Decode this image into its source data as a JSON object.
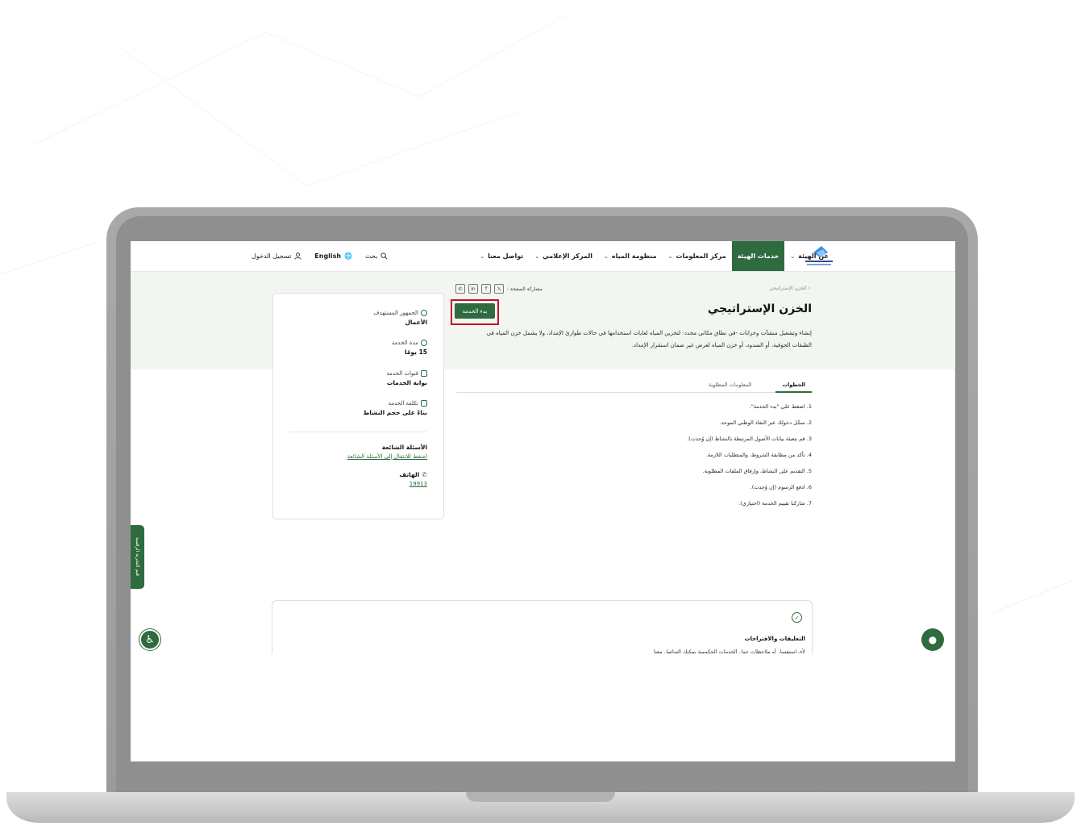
{
  "header": {
    "nav": [
      {
        "label": "عن الهيئة",
        "active": false,
        "dropdown": true
      },
      {
        "label": "خدمات الهيئة",
        "active": true,
        "dropdown": false
      },
      {
        "label": "مركز المعلومات",
        "active": false,
        "dropdown": true
      },
      {
        "label": "منظومة المياه",
        "active": false,
        "dropdown": true
      },
      {
        "label": "المركز الإعلامي",
        "active": false,
        "dropdown": true
      },
      {
        "label": "تواصل معنا",
        "active": false,
        "dropdown": true
      }
    ],
    "search_label": "بحث",
    "language_label": "English",
    "login_label": "تسجيل الدخول"
  },
  "breadcrumb": "الخزن الإستراتيجي",
  "share": {
    "label": "مشاركة الصفحة :",
    "icons": [
      "x-icon",
      "facebook-icon",
      "linkedin-icon",
      "whatsapp-icon"
    ]
  },
  "page": {
    "title": "الخزن الإستراتيجي",
    "description": "إنشاء وتشغيل منشآت وخزانات -في نطاق مكاني محدد- لتخزين المياه لغايات استخدامها في حالات طوارئ الإمداد، ولا يشمل خزن المياه في الطبقات الجوفية، أو السدود، أو خزن المياه لغرض غير ضمان استقرار الإمداد.",
    "start_button": "بدء الخدمة"
  },
  "info_card": {
    "audience_label": "الجمهور المستهدف",
    "audience_value": "الأعمال",
    "duration_label": "مدة الخدمة",
    "duration_value": "15 يومًا",
    "channels_label": "قنوات الخدمة",
    "channels_value": "بوابة الخدمات",
    "cost_label": "تكلفة الخدمة",
    "cost_value": "بناءً على حجم النشاط",
    "faq_label": "الأسئلة الشائعة",
    "faq_link": "اضغط للانتقال إلى الأسئلة الشائعة",
    "phone_label": "الهاتف",
    "phone_value": "19913"
  },
  "tabs": [
    {
      "label": "الخطوات",
      "active": true
    },
    {
      "label": "المعلومات المطلوبة",
      "active": false
    }
  ],
  "steps": [
    "1. اضغط على \"بدء الخدمة\".",
    "2. سجّل دخولك عبر النفاذ الوطني الموحد.",
    "3. قم بتعبئة بيانات الأصول المرتبطة بالنشاط (إن وُجدت).",
    "4. تأكد من مطابقة الشروط، والمتطلبات اللازمة.",
    "5. التقديم على النشاط، وإرفاق الملفات المطلوبة.",
    "6. ادفع الرسوم (إن وُجدت).",
    "7. شاركنا تقييم الخدمة (اختياري)."
  ],
  "feedback": {
    "title": "التعليقات والاقتراحات",
    "subtitle": "لأي استفسار أو ملاحظات حول الخدمات الحكومية يمكنك التواصل معنا"
  },
  "side_tab_label": "قيم التجربة الرقمية",
  "colors": {
    "brand_green": "#2e6b3e",
    "hero_bg": "#f1f6f0",
    "highlight_red": "#c8102e"
  }
}
